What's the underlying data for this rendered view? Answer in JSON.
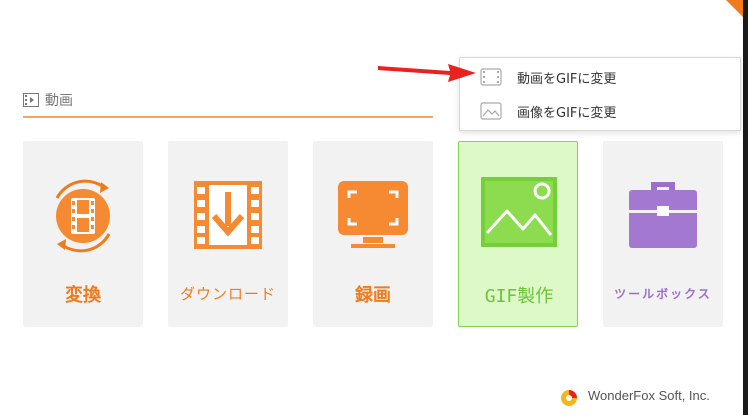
{
  "section": {
    "title": "動画",
    "icon": "film-strip-icon"
  },
  "tiles": [
    {
      "label": "変換",
      "icon": "convert-film-icon"
    },
    {
      "label": "ダウンロード",
      "icon": "download-icon"
    },
    {
      "label": "録画",
      "icon": "screen-record-icon"
    },
    {
      "label": "GIF製作",
      "icon": "image-landscape-icon"
    },
    {
      "label": "ツールボックス",
      "icon": "toolbox-icon"
    }
  ],
  "dropdown": {
    "items": [
      {
        "label": "動画をGIFに変更",
        "icon": "video-frame-icon"
      },
      {
        "label": "画像をGIFに変更",
        "icon": "image-frame-icon"
      }
    ]
  },
  "brand": {
    "name": "WonderFox Soft, Inc."
  },
  "colors": {
    "accent": "#f07b1c",
    "gif_green": "#7ed64d",
    "gif_bg": "#ddf9c8",
    "toolbox_purple": "#9d6fc9",
    "arrow_red": "#e8231d"
  }
}
